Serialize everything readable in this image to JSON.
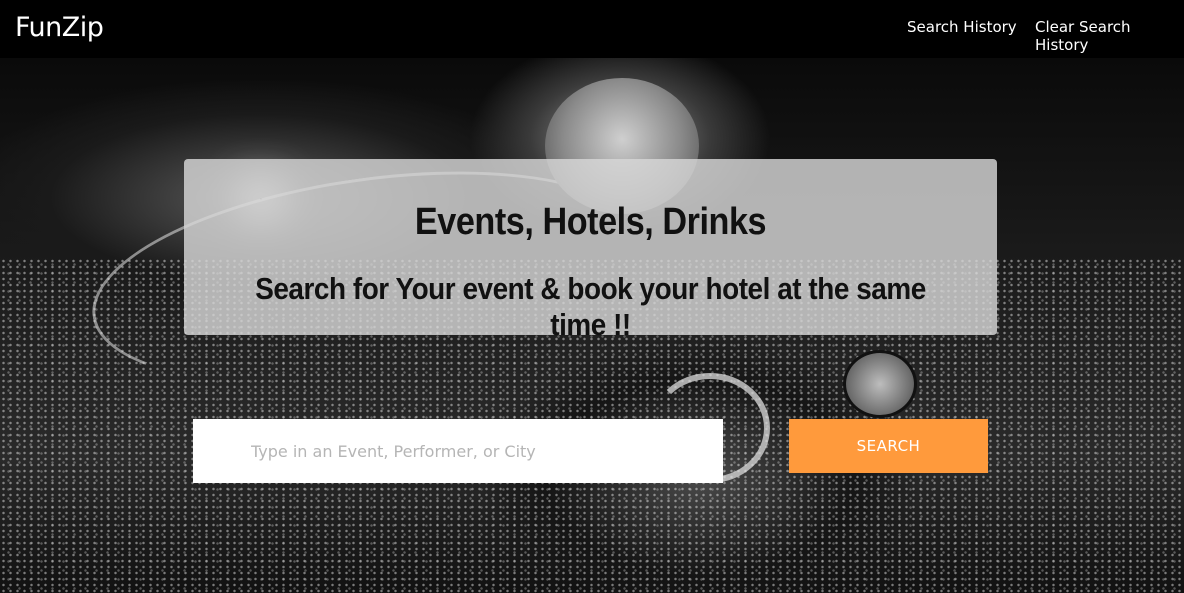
{
  "navbar": {
    "brand": "FunZip",
    "links": [
      {
        "label": "Search History"
      },
      {
        "label": "Clear Search History"
      }
    ]
  },
  "hero": {
    "title": "Events, Hotels, Drinks",
    "subtitle": "Search for Your event & book your hotel at the same time !!"
  },
  "search": {
    "placeholder": "Type in an Event, Performer, or City",
    "value": "",
    "button_label": "SEARCH"
  },
  "colors": {
    "navbar_bg": "#000000",
    "accent": "#ff9a3c",
    "panel_bg": "#d7d7d7"
  }
}
